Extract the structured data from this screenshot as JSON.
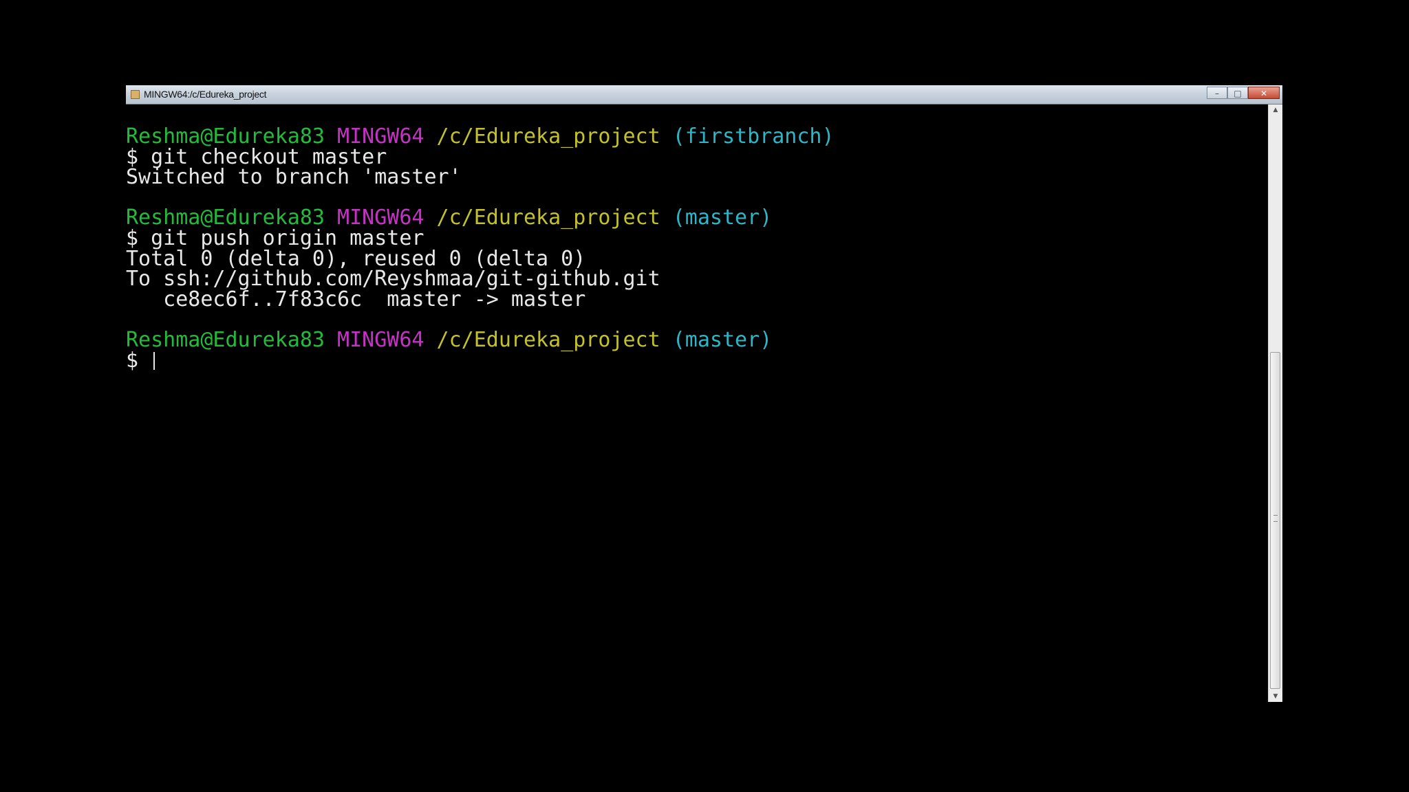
{
  "window": {
    "title": "MINGW64:/c/Edureka_project",
    "minimize_label": "–",
    "maximize_label": "□",
    "close_label": "✕"
  },
  "terminal": {
    "lines": [
      {
        "type": "prompt",
        "user": "Reshma@Edureka83",
        "system": "MINGW64",
        "path": "/c/Edureka_project",
        "branch": "(firstbranch)"
      },
      {
        "type": "command",
        "text": "$ git checkout master"
      },
      {
        "type": "output",
        "text": "Switched to branch 'master'"
      },
      {
        "type": "blank",
        "text": ""
      },
      {
        "type": "prompt",
        "user": "Reshma@Edureka83",
        "system": "MINGW64",
        "path": "/c/Edureka_project",
        "branch": "(master)"
      },
      {
        "type": "command",
        "text": "$ git push origin master"
      },
      {
        "type": "output",
        "text": "Total 0 (delta 0), reused 0 (delta 0)"
      },
      {
        "type": "output",
        "text": "To ssh://github.com/Reyshmaa/git-github.git"
      },
      {
        "type": "output",
        "text": "   ce8ec6f..7f83c6c  master -> master"
      },
      {
        "type": "blank",
        "text": ""
      },
      {
        "type": "prompt",
        "user": "Reshma@Edureka83",
        "system": "MINGW64",
        "path": "/c/Edureka_project",
        "branch": "(master)"
      },
      {
        "type": "input",
        "text": "$ "
      }
    ]
  },
  "scrollbar": {
    "up_icon": "arrow-up-icon",
    "down_icon": "arrow-down-icon"
  },
  "colors": {
    "user": "#23bb3b",
    "system": "#c434c4",
    "path": "#c4c22a",
    "branch": "#2bb7c7",
    "text": "#e8e8e8",
    "background": "#000000"
  }
}
